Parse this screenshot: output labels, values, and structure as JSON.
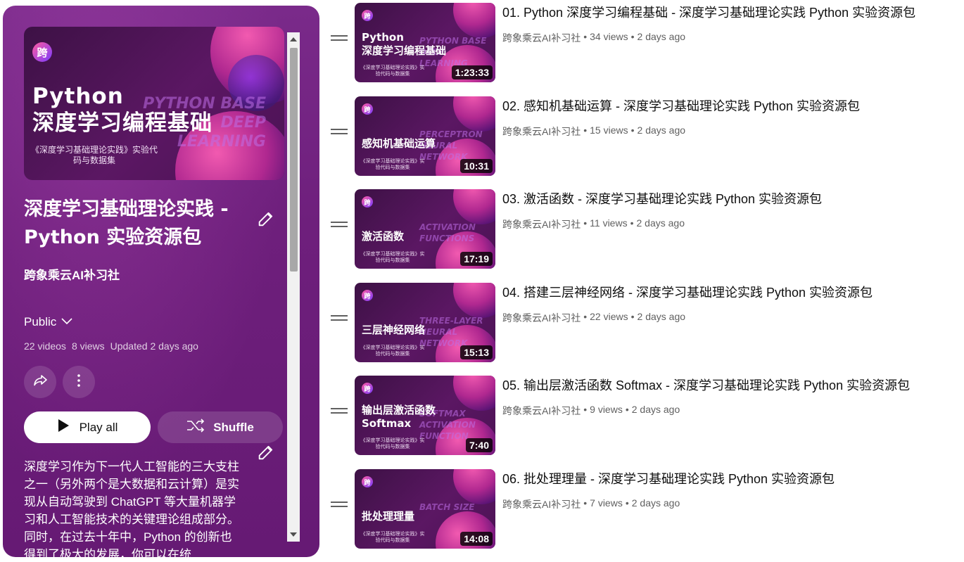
{
  "playlist": {
    "hero_logo": "跨",
    "hero_title_lines": [
      "Python",
      "深度学习编程基础"
    ],
    "hero_en_lines": [
      "PYTHON BASE",
      "DEEP",
      "LEARNING"
    ],
    "hero_sub": "《深度学习基础理论实践》实验代码与数据集",
    "title": "深度学习基础理论实践 - Python 实验资源包",
    "channel": "跨象乘云AI补习社",
    "privacy": "Public",
    "stats": {
      "videos": "22 videos",
      "views": "8 views",
      "updated": "Updated 2 days ago"
    },
    "play_all_label": "Play all",
    "shuffle_label": "Shuffle",
    "description": "深度学习作为下一代人工智能的三大支柱之一（另外两个是大数据和云计算）是实现从自动驾驶到 ChatGPT 等大量机器学习和人工智能技术的关键理论组成部分。同时，在过去十年中，Python 的创新也得到了极大的发展，你可以在统"
  },
  "icons": {
    "edit": "pencil-icon",
    "chevron": "chevron-down-icon",
    "share": "share-icon",
    "more": "more-vert-icon",
    "play": "play-icon",
    "shuffle": "shuffle-icon",
    "drag": "drag-handle-icon"
  },
  "videos": [
    {
      "title": "01. Python 深度学习编程基础 - 深度学习基础理论实践 Python 实验资源包",
      "channel": "跨象乘云AI补习社",
      "views": "34 views",
      "age": "2 days ago",
      "duration": "1:23:33",
      "thumb_lines": [
        "Python",
        "深度学习编程基础"
      ],
      "thumb_en": [
        "PYTHON BASE",
        "DEEP",
        "LEARNING"
      ]
    },
    {
      "title": "02. 感知机基础运算 - 深度学习基础理论实践 Python 实验资源包",
      "channel": "跨象乘云AI补习社",
      "views": "15 views",
      "age": "2 days ago",
      "duration": "10:31",
      "thumb_lines": [
        "感知机基础运算"
      ],
      "thumb_en": [
        "PERCEPTRON",
        "NEURAL",
        "NETWORK"
      ]
    },
    {
      "title": "03. 激活函数 - 深度学习基础理论实践 Python 实验资源包",
      "channel": "跨象乘云AI补习社",
      "views": "11 views",
      "age": "2 days ago",
      "duration": "17:19",
      "thumb_lines": [
        "激活函数"
      ],
      "thumb_en": [
        "ACTIVATION",
        "FUNCTIONS"
      ]
    },
    {
      "title": "04. 搭建三层神经网络 - 深度学习基础理论实践 Python 实验资源包",
      "channel": "跨象乘云AI补习社",
      "views": "22 views",
      "age": "2 days ago",
      "duration": "15:13",
      "thumb_lines": [
        "三层神经网络"
      ],
      "thumb_en": [
        "THREE-LAYER",
        "NEURAL",
        "NETWORK"
      ]
    },
    {
      "title": "05. 输出层激活函数 Softmax - 深度学习基础理论实践 Python 实验资源包",
      "channel": "跨象乘云AI补习社",
      "views": "9 views",
      "age": "2 days ago",
      "duration": "7:40",
      "thumb_lines": [
        "输出层激活函数",
        "Softmax"
      ],
      "thumb_en": [
        "SOFTMAX",
        "ACTIVATION",
        "FUNCTION"
      ]
    },
    {
      "title": "06. 批处理理量 - 深度学习基础理论实践 Python 实验资源包",
      "channel": "跨象乘云AI补习社",
      "views": "7 views",
      "age": "2 days ago",
      "duration": "14:08",
      "thumb_lines": [
        "批处理理量"
      ],
      "thumb_en": [
        "BATCH SIZE"
      ]
    }
  ],
  "thumb_sub": "《深度学习基础理论实践》实验代码与数据集",
  "thumb_logo": "跨",
  "colors": {
    "panel": "#6e1f7c",
    "accent_pink": "#f25ab0",
    "accent_purple": "#7a3aff"
  }
}
